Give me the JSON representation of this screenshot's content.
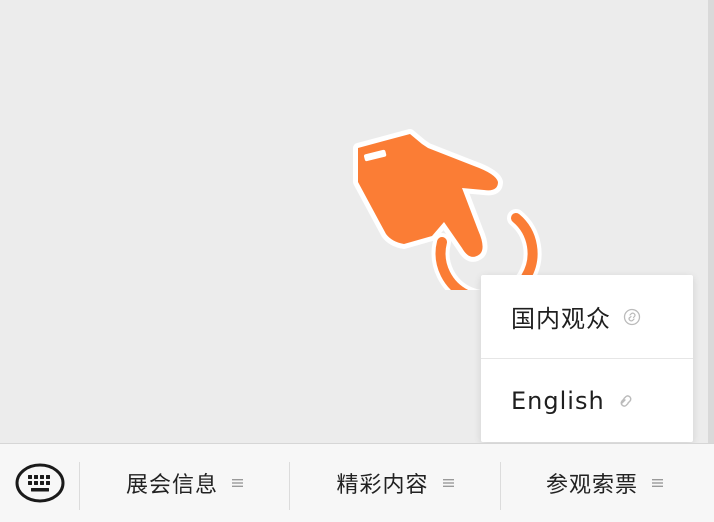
{
  "popup": {
    "items": [
      {
        "label": "国内观众",
        "icon": "link-icon"
      },
      {
        "label": "English",
        "icon": "link-icon"
      }
    ]
  },
  "bottom_menu": {
    "keyboard_icon": "keyboard-icon",
    "items": [
      {
        "label": "展会信息",
        "icon": "menu-lines-icon"
      },
      {
        "label": "精彩内容",
        "icon": "menu-lines-icon"
      },
      {
        "label": "参观索票",
        "icon": "menu-lines-icon"
      }
    ]
  },
  "colors": {
    "accent": "#fb7d35",
    "background": "#ececec",
    "menu_background": "#f7f7f7",
    "popup_background": "#ffffff"
  }
}
